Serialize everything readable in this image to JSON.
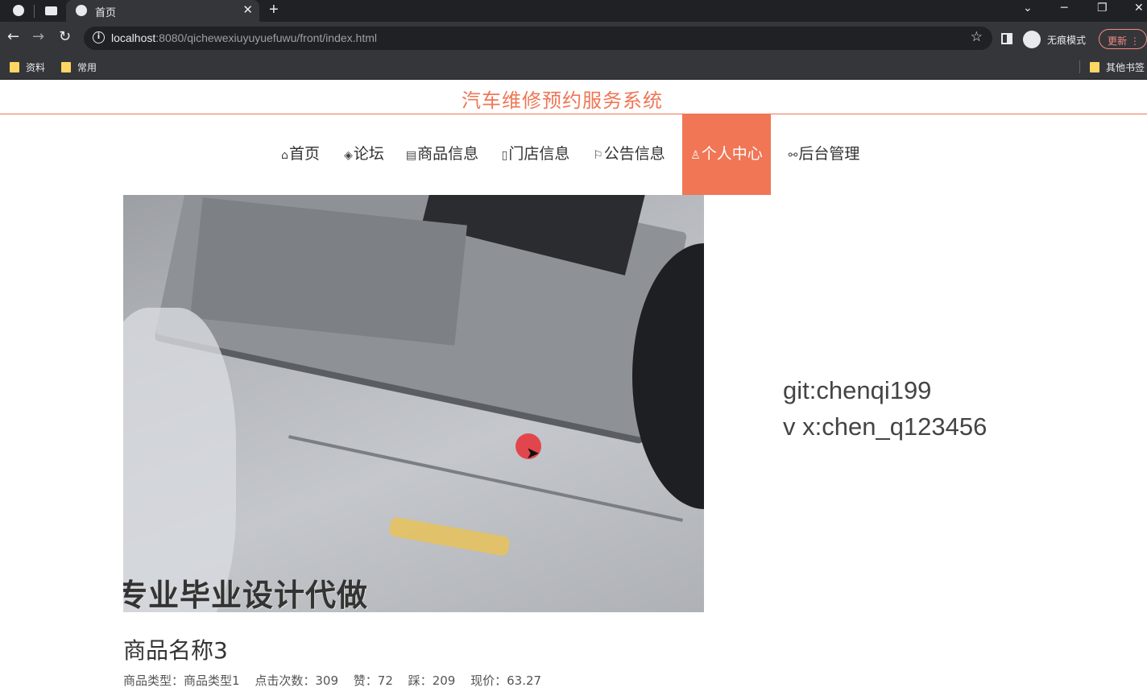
{
  "browser": {
    "tab_title": "首页",
    "url_host": "localhost",
    "url_rest": ":8080/qichewexiuyuyuefuwu/front/index.html",
    "incognito_label": "无痕模式",
    "update_label": "更新",
    "bookmarks": [
      "资料",
      "常用"
    ],
    "other_bookmarks": "其他书签"
  },
  "site": {
    "title": "汽车维修预约服务系统"
  },
  "nav": {
    "items": [
      {
        "icon": "⌂",
        "label": "首页"
      },
      {
        "icon": "◈",
        "label": "论坛"
      },
      {
        "icon": "▤",
        "label": "商品信息"
      },
      {
        "icon": "▯",
        "label": "门店信息"
      },
      {
        "icon": "⚐",
        "label": "公告信息"
      },
      {
        "icon": "♙",
        "label": "个人中心"
      },
      {
        "icon": "⚯",
        "label": "后台管理"
      }
    ],
    "active_index": 5
  },
  "video": {
    "caption": "专业毕业设计代做"
  },
  "contact": {
    "line1": "git:chenqi199",
    "line2": "v x:chen_q123456"
  },
  "product": {
    "name": "商品名称3",
    "type_label": "商品类型：",
    "type_value": "商品类型1",
    "clicks_label": "点击次数：",
    "clicks_value": "309",
    "likes_label": "赞：",
    "likes_value": "72",
    "dislikes_label": "踩：",
    "dislikes_value": "209",
    "price_label": "现价：",
    "price_value": "63.27"
  },
  "colors": {
    "accent": "#f07655"
  }
}
